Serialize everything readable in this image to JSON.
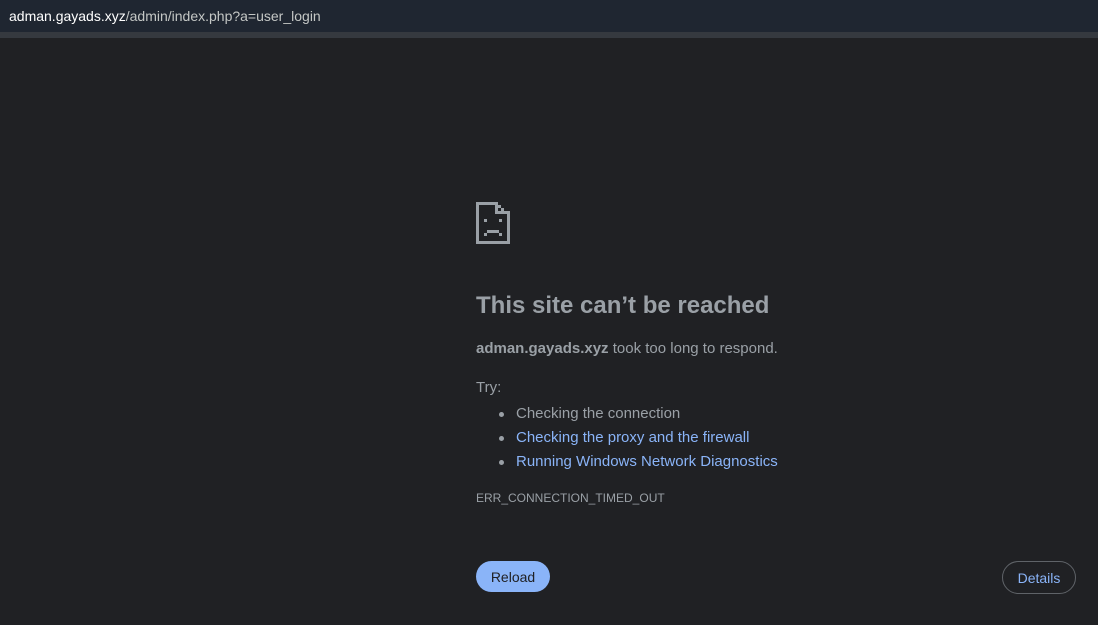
{
  "address_bar": {
    "host": "adman.gayads.xyz",
    "path": "/admin/index.php?a=user_login"
  },
  "error_page": {
    "icon": "sad-page-icon",
    "title": "This site can’t be reached",
    "message_host": "adman.gayads.xyz",
    "message_rest": " took too long to respond.",
    "try_label": "Try:",
    "suggestions": [
      "Checking the connection",
      "Checking the proxy and the firewall",
      "Running Windows Network Diagnostics"
    ],
    "error_code": "ERR_CONNECTION_TIMED_OUT",
    "reload_label": "Reload",
    "details_label": "Details"
  },
  "colors": {
    "background": "#202124",
    "text": "#9aa0a6",
    "link": "#8ab4f8",
    "button_fill": "#8ab4f8"
  }
}
